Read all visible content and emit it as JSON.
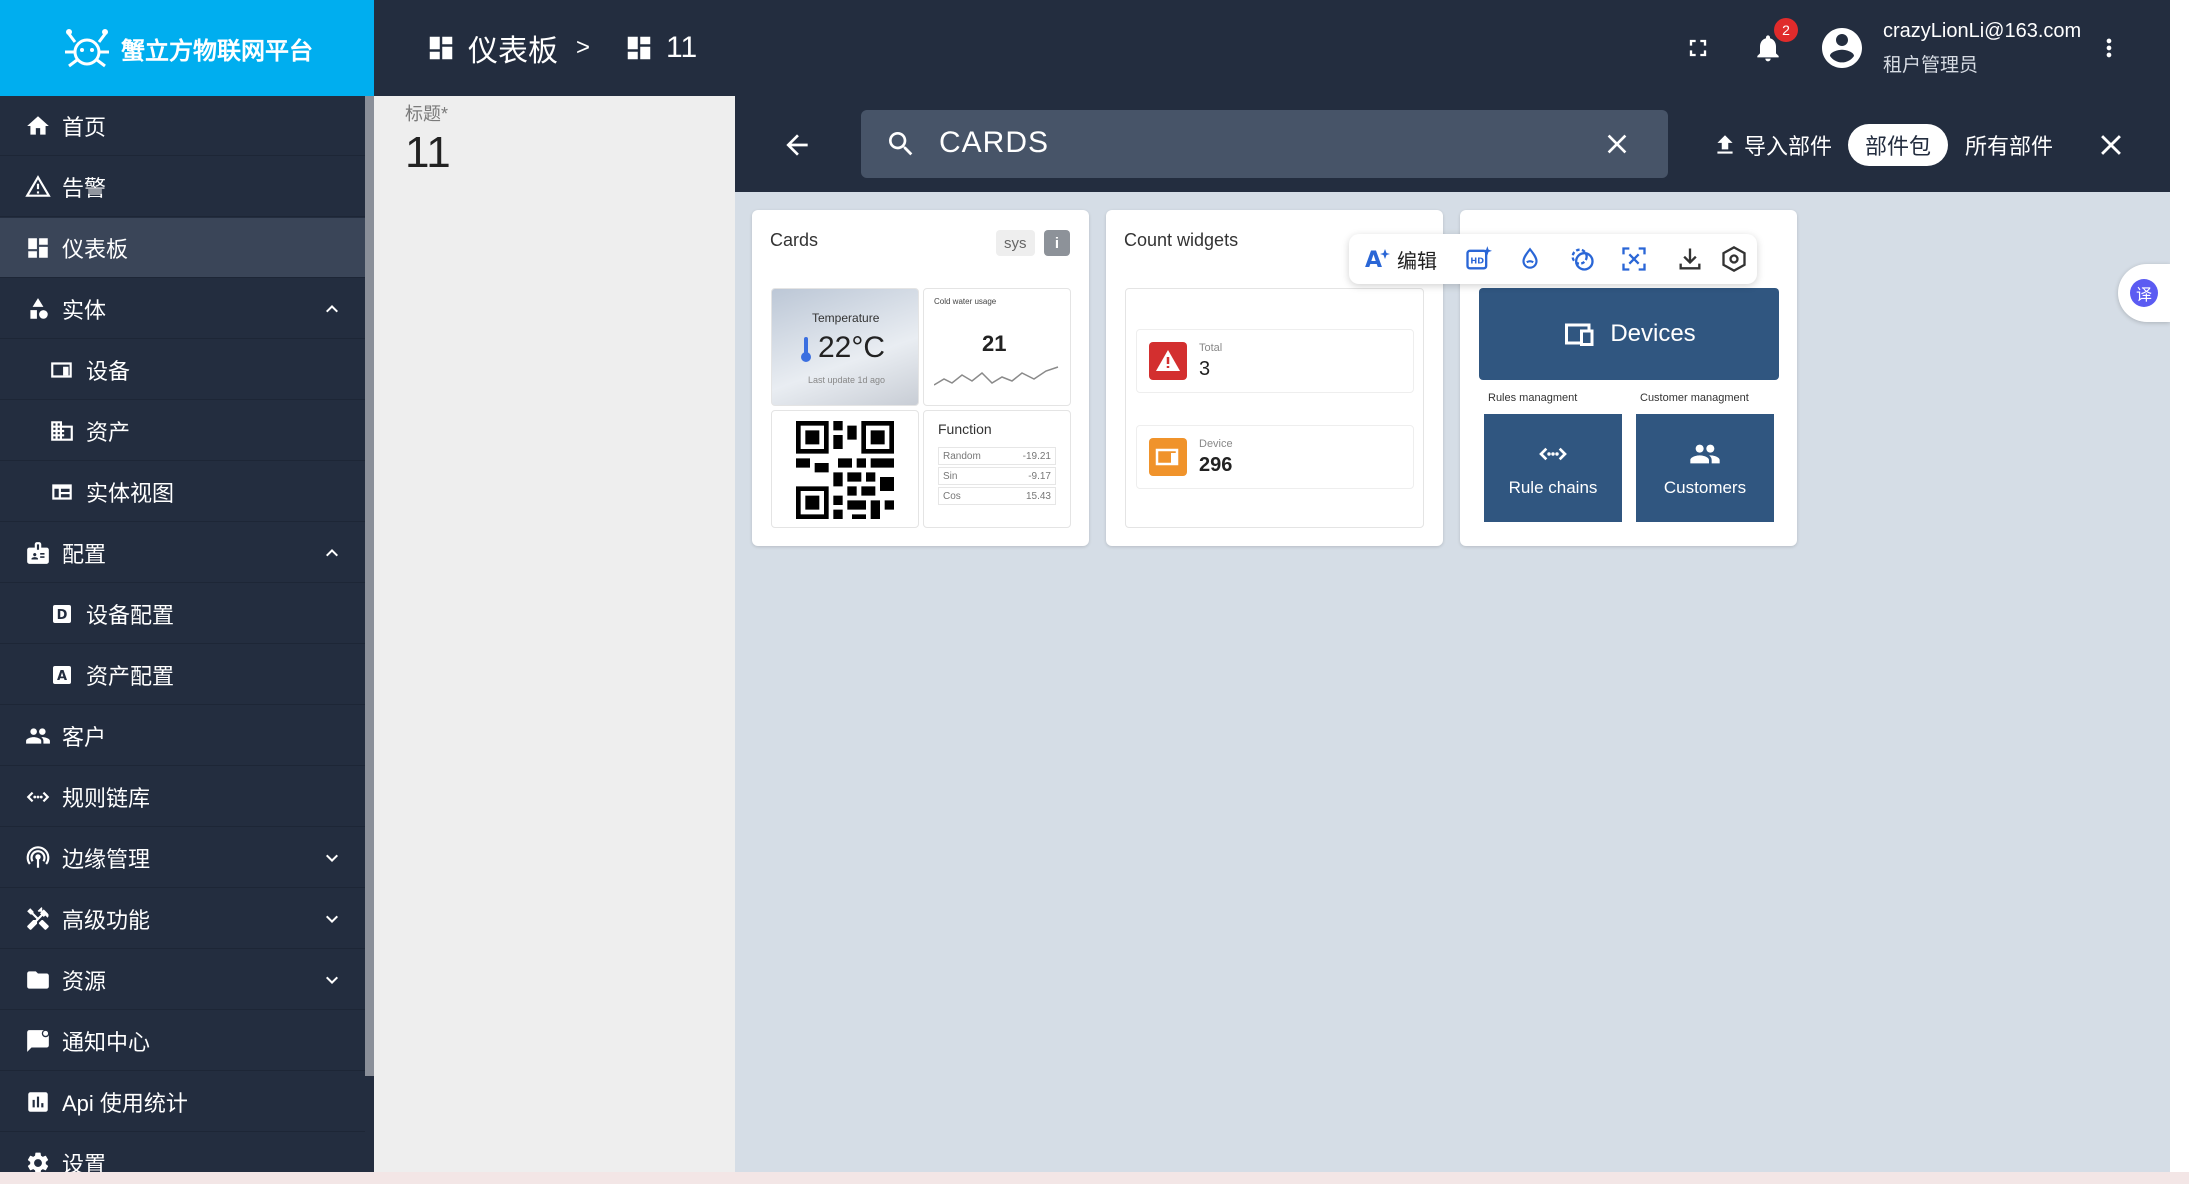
{
  "app": {
    "name": "蟹立方物联网平台"
  },
  "breadcrumb": {
    "first": "仪表板",
    "separator": ">",
    "second": "11"
  },
  "header": {
    "notification_count": "2",
    "user_email": "crazyLionLi@163.com",
    "user_role": "租户管理员"
  },
  "sidebar": {
    "items": [
      {
        "label": "首页",
        "icon": "home-icon"
      },
      {
        "label": "告警",
        "icon": "warning-icon"
      },
      {
        "label": "仪表板",
        "icon": "dashboard-icon"
      },
      {
        "label": "实体",
        "icon": "entity-icon"
      },
      {
        "label": "设备",
        "icon": "devices-icon"
      },
      {
        "label": "资产",
        "icon": "domain-icon"
      },
      {
        "label": "实体视图",
        "icon": "view-icon"
      },
      {
        "label": "配置",
        "icon": "config-icon"
      },
      {
        "label": "设备配置",
        "icon": "device-profile-icon"
      },
      {
        "label": "资产配置",
        "icon": "asset-profile-icon"
      },
      {
        "label": "客户",
        "icon": "customers-icon"
      },
      {
        "label": "规则链库",
        "icon": "rule-chain-icon"
      },
      {
        "label": "边缘管理",
        "icon": "edge-icon"
      },
      {
        "label": "高级功能",
        "icon": "tools-icon"
      },
      {
        "label": "资源",
        "icon": "folder-icon"
      },
      {
        "label": "通知中心",
        "icon": "notification-center-icon"
      },
      {
        "label": "Api 使用统计",
        "icon": "chart-icon"
      },
      {
        "label": "设置",
        "icon": "settings-icon"
      }
    ]
  },
  "dashboard": {
    "title_label": "标题*",
    "title_value": "11"
  },
  "selector": {
    "search_value": "CARDS",
    "import_label": "导入部件",
    "bundles_label": "部件包",
    "all_widgets_label": "所有部件"
  },
  "cards": [
    {
      "title": "Cards",
      "tag": "sys",
      "info": "i",
      "preview": {
        "temperature_label": "Temperature",
        "temperature_value": "22°C",
        "temperature_sub": "Last update 1d ago",
        "water_label": "Cold water usage",
        "water_value": "21",
        "function_title": "Function",
        "function_rows": [
          {
            "name": "Random",
            "value": "-19.21"
          },
          {
            "name": "Sin",
            "value": "-9.17"
          },
          {
            "name": "Cos",
            "value": "15.43"
          }
        ]
      }
    },
    {
      "title": "Count widgets",
      "preview": {
        "row1_label": "Total",
        "row1_value": "3",
        "row2_label": "Device",
        "row2_value": "296"
      }
    },
    {
      "preview": {
        "devices_label": "Devices",
        "rules_header": "Rules managment",
        "customers_header": "Customer managment",
        "rule_chains_label": "Rule chains",
        "customers_label": "Customers"
      }
    }
  ],
  "float_toolbar": {
    "edit_label": "编辑"
  },
  "translate": {
    "label": "译"
  },
  "colors": {
    "topbar": "#232d3f",
    "logo_bg": "#00aeef",
    "selector_body": "#d5dde6",
    "tile_blue": "#305680",
    "alert_red": "#d32f2f",
    "device_orange": "#f0932b"
  }
}
